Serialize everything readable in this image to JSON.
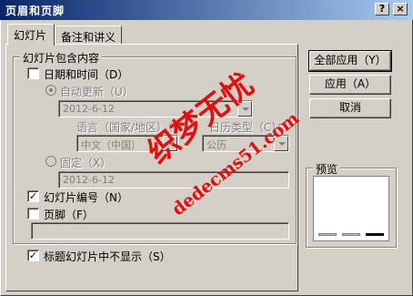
{
  "window": {
    "title": "页眉和页脚"
  },
  "title_buttons": {
    "help": "?",
    "close": "×"
  },
  "tabs": [
    {
      "label": "幻灯片"
    },
    {
      "label": "备注和讲义"
    }
  ],
  "slide_group": {
    "label": "幻灯片包含内容"
  },
  "date_time": {
    "label": "日期和时间（D）",
    "checked": false,
    "auto_update_label": "自动更新（U）",
    "auto_update_value": "2012-6-12",
    "language_label": "语言（国家/地区）（L）：",
    "calendar_label": "日历类型（C）：",
    "language_value": "中文（中国）",
    "calendar_value": "公历",
    "fixed_label": "固定（X）",
    "fixed_value": "2012-6-12"
  },
  "slide_number": {
    "label": "幻灯片编号（N）",
    "checked": true
  },
  "footer": {
    "label": "页脚（F）",
    "checked": false,
    "value": ""
  },
  "hide_on_title": {
    "label": "标题幻灯片中不显示（S）",
    "checked": true
  },
  "buttons": {
    "apply_all": "全部应用（Y）",
    "apply": "应用（A）",
    "cancel": "取消"
  },
  "preview": {
    "label": "预览"
  },
  "watermark": {
    "line1": "织梦无忧",
    "line2": "dedecms51.com",
    "color": "#e01010"
  },
  "colors": {
    "dialog": "#d4d0c8",
    "titlebar_start": "#0a246a",
    "titlebar_end": "#a6caf0"
  }
}
